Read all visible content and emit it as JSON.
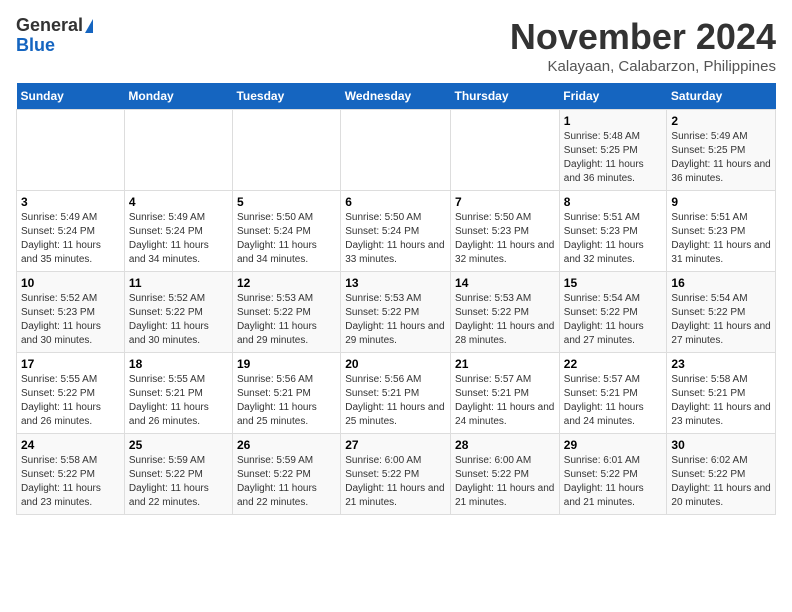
{
  "logo": {
    "line1": "General",
    "line2": "Blue"
  },
  "header": {
    "month": "November 2024",
    "location": "Kalayaan, Calabarzon, Philippines"
  },
  "days_of_week": [
    "Sunday",
    "Monday",
    "Tuesday",
    "Wednesday",
    "Thursday",
    "Friday",
    "Saturday"
  ],
  "weeks": [
    [
      {
        "day": "",
        "info": ""
      },
      {
        "day": "",
        "info": ""
      },
      {
        "day": "",
        "info": ""
      },
      {
        "day": "",
        "info": ""
      },
      {
        "day": "",
        "info": ""
      },
      {
        "day": "1",
        "info": "Sunrise: 5:48 AM\nSunset: 5:25 PM\nDaylight: 11 hours and 36 minutes."
      },
      {
        "day": "2",
        "info": "Sunrise: 5:49 AM\nSunset: 5:25 PM\nDaylight: 11 hours and 36 minutes."
      }
    ],
    [
      {
        "day": "3",
        "info": "Sunrise: 5:49 AM\nSunset: 5:24 PM\nDaylight: 11 hours and 35 minutes."
      },
      {
        "day": "4",
        "info": "Sunrise: 5:49 AM\nSunset: 5:24 PM\nDaylight: 11 hours and 34 minutes."
      },
      {
        "day": "5",
        "info": "Sunrise: 5:50 AM\nSunset: 5:24 PM\nDaylight: 11 hours and 34 minutes."
      },
      {
        "day": "6",
        "info": "Sunrise: 5:50 AM\nSunset: 5:24 PM\nDaylight: 11 hours and 33 minutes."
      },
      {
        "day": "7",
        "info": "Sunrise: 5:50 AM\nSunset: 5:23 PM\nDaylight: 11 hours and 32 minutes."
      },
      {
        "day": "8",
        "info": "Sunrise: 5:51 AM\nSunset: 5:23 PM\nDaylight: 11 hours and 32 minutes."
      },
      {
        "day": "9",
        "info": "Sunrise: 5:51 AM\nSunset: 5:23 PM\nDaylight: 11 hours and 31 minutes."
      }
    ],
    [
      {
        "day": "10",
        "info": "Sunrise: 5:52 AM\nSunset: 5:23 PM\nDaylight: 11 hours and 30 minutes."
      },
      {
        "day": "11",
        "info": "Sunrise: 5:52 AM\nSunset: 5:22 PM\nDaylight: 11 hours and 30 minutes."
      },
      {
        "day": "12",
        "info": "Sunrise: 5:53 AM\nSunset: 5:22 PM\nDaylight: 11 hours and 29 minutes."
      },
      {
        "day": "13",
        "info": "Sunrise: 5:53 AM\nSunset: 5:22 PM\nDaylight: 11 hours and 29 minutes."
      },
      {
        "day": "14",
        "info": "Sunrise: 5:53 AM\nSunset: 5:22 PM\nDaylight: 11 hours and 28 minutes."
      },
      {
        "day": "15",
        "info": "Sunrise: 5:54 AM\nSunset: 5:22 PM\nDaylight: 11 hours and 27 minutes."
      },
      {
        "day": "16",
        "info": "Sunrise: 5:54 AM\nSunset: 5:22 PM\nDaylight: 11 hours and 27 minutes."
      }
    ],
    [
      {
        "day": "17",
        "info": "Sunrise: 5:55 AM\nSunset: 5:22 PM\nDaylight: 11 hours and 26 minutes."
      },
      {
        "day": "18",
        "info": "Sunrise: 5:55 AM\nSunset: 5:21 PM\nDaylight: 11 hours and 26 minutes."
      },
      {
        "day": "19",
        "info": "Sunrise: 5:56 AM\nSunset: 5:21 PM\nDaylight: 11 hours and 25 minutes."
      },
      {
        "day": "20",
        "info": "Sunrise: 5:56 AM\nSunset: 5:21 PM\nDaylight: 11 hours and 25 minutes."
      },
      {
        "day": "21",
        "info": "Sunrise: 5:57 AM\nSunset: 5:21 PM\nDaylight: 11 hours and 24 minutes."
      },
      {
        "day": "22",
        "info": "Sunrise: 5:57 AM\nSunset: 5:21 PM\nDaylight: 11 hours and 24 minutes."
      },
      {
        "day": "23",
        "info": "Sunrise: 5:58 AM\nSunset: 5:21 PM\nDaylight: 11 hours and 23 minutes."
      }
    ],
    [
      {
        "day": "24",
        "info": "Sunrise: 5:58 AM\nSunset: 5:22 PM\nDaylight: 11 hours and 23 minutes."
      },
      {
        "day": "25",
        "info": "Sunrise: 5:59 AM\nSunset: 5:22 PM\nDaylight: 11 hours and 22 minutes."
      },
      {
        "day": "26",
        "info": "Sunrise: 5:59 AM\nSunset: 5:22 PM\nDaylight: 11 hours and 22 minutes."
      },
      {
        "day": "27",
        "info": "Sunrise: 6:00 AM\nSunset: 5:22 PM\nDaylight: 11 hours and 21 minutes."
      },
      {
        "day": "28",
        "info": "Sunrise: 6:00 AM\nSunset: 5:22 PM\nDaylight: 11 hours and 21 minutes."
      },
      {
        "day": "29",
        "info": "Sunrise: 6:01 AM\nSunset: 5:22 PM\nDaylight: 11 hours and 21 minutes."
      },
      {
        "day": "30",
        "info": "Sunrise: 6:02 AM\nSunset: 5:22 PM\nDaylight: 11 hours and 20 minutes."
      }
    ]
  ]
}
